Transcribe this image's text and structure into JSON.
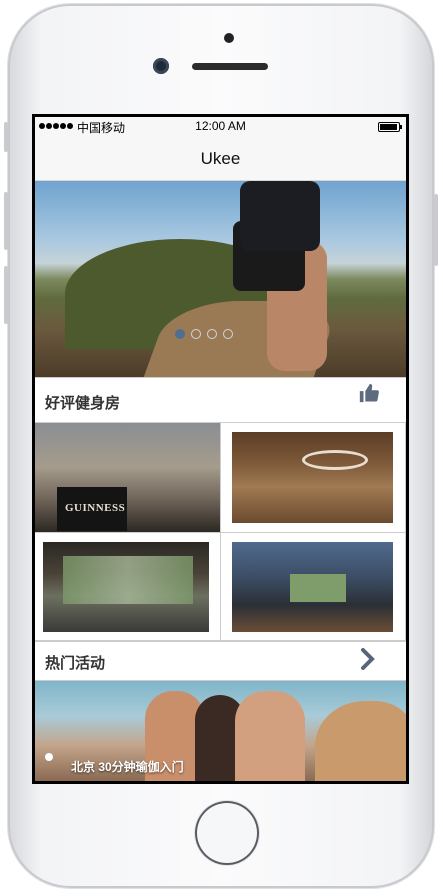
{
  "status_bar": {
    "carrier": "中国移动",
    "time": "12:00 AM"
  },
  "app": {
    "title": "Ukee"
  },
  "banner": {
    "slide_count": 4,
    "active_slide": 1
  },
  "gyms_section": {
    "title": "好评健身房",
    "icon": "thumbs-up-icon"
  },
  "gyms": [
    {
      "name": "gym-photo-1",
      "sign_text": "GUINNESS"
    },
    {
      "name": "gym-photo-2"
    },
    {
      "name": "gym-photo-3"
    },
    {
      "name": "gym-photo-4"
    }
  ],
  "events_section": {
    "title": "热门活动",
    "icon": "chevron-right-icon"
  },
  "event": {
    "caption": "北京 30分钟瑜伽入门"
  },
  "colors": {
    "icon": "#5c6b7e",
    "dot_active": "#4d6f92"
  }
}
